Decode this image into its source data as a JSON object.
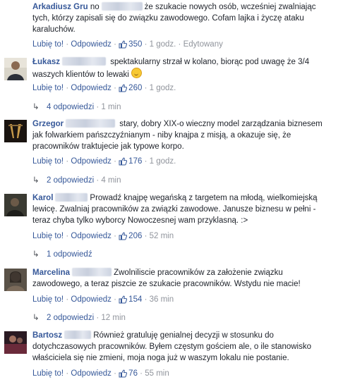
{
  "actions": {
    "like": "Lubię to!",
    "reply": "Odpowiedz",
    "sep": "·"
  },
  "comments": [
    {
      "author": "Arkadiusz Gru",
      "text_before": "no",
      "text_after": "że szukacie nowych osób, wcześniej zwalniając tych, którzy zapisali się do związku zawodowego. Cofam lajka i życzę ataku karaluchów.",
      "likes": "350",
      "time": "1 godz.",
      "edited": "Edytowany",
      "replies": ""
    },
    {
      "author": "Łukasz",
      "text_before": "",
      "text_after": "spektakularny strzał w kolano, biorąc pod uwagę że 3/4 waszych klientów to lewaki",
      "likes": "260",
      "time": "1 godz.",
      "edited": "",
      "replies": "4 odpowiedzi",
      "replies_time": "1 min"
    },
    {
      "author": "Grzegor",
      "text_before": "",
      "text_after": "stary, dobry XIX-o wieczny model zarządzania biznesem jak folwarkiem pańszczyźnianym - niby knajpa z misją, a okazuje się, że pracowników traktujecie jak typowe korpo.",
      "likes": "176",
      "time": "1 godz.",
      "edited": "",
      "replies": "2 odpowiedzi",
      "replies_time": "4 min"
    },
    {
      "author": "Karol",
      "text_before": "",
      "text_after": "Prowadź knajpę wegańską z targetem na młodą, wielkomiejską lewicę. Zwalniaj pracowników za związki zawodowe. Janusze biznesu w pełni - teraz chyba tylko wyborcy Nowoczesnej wam przyklasną. :>",
      "likes": "206",
      "time": "52 min",
      "edited": "",
      "replies": "1 odpowiedź",
      "replies_time": ""
    },
    {
      "author": "Marcelina",
      "text_before": "",
      "text_after": "Zwolniliscie pracowników za założenie związku zawodowego, a teraz piszcie ze szukacie pracowników. Wstydu nie macie!",
      "likes": "154",
      "time": "36 min",
      "edited": "",
      "replies": "2 odpowiedzi",
      "replies_time": "12 min"
    },
    {
      "author": "Bartosz",
      "text_before": "",
      "text_after": "Również gratuluję genialnej decyzji w stosunku do dotychczasowych pracowników. Byłem częstym gościem ale, o ile stanowisko właściciela się nie zmieni, moja noga już w waszym lokalu nie postanie.",
      "likes": "76",
      "time": "55 min",
      "edited": "",
      "replies": ""
    }
  ],
  "icons": {
    "like": "thumbs-up-icon",
    "reply_arrow": "reply-arrow-icon",
    "emoji": "grinning-face-icon"
  },
  "colors": {
    "link": "#365899",
    "meta": "#90949c",
    "text": "#1d2129"
  }
}
